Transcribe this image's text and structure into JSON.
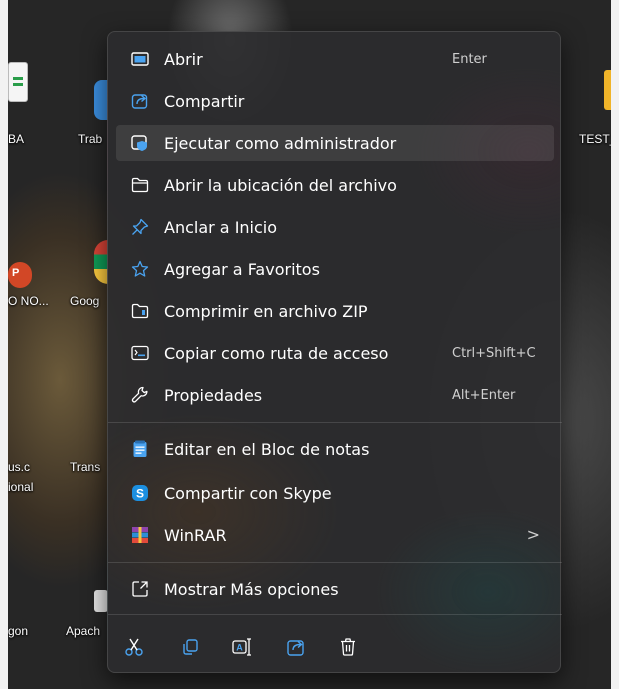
{
  "desktop": {
    "labels": [
      "BA",
      "Trab",
      "TEST_",
      "O NO...",
      "Goog",
      "us.c",
      "ional",
      "Trans",
      "gon",
      "Apach"
    ]
  },
  "menu": {
    "items": [
      {
        "label": "Abrir",
        "shortcut": "Enter",
        "icon": "open-icon"
      },
      {
        "label": "Compartir",
        "shortcut": "",
        "icon": "share-icon"
      },
      {
        "label": "Ejecutar como administrador",
        "shortcut": "",
        "icon": "admin-shield-icon"
      },
      {
        "label": "Abrir la ubicación del archivo",
        "shortcut": "",
        "icon": "folder-icon"
      },
      {
        "label": "Anclar a Inicio",
        "shortcut": "",
        "icon": "pin-icon"
      },
      {
        "label": "Agregar a Favoritos",
        "shortcut": "",
        "icon": "star-icon"
      },
      {
        "label": "Comprimir en archivo ZIP",
        "shortcut": "",
        "icon": "zip-folder-icon"
      },
      {
        "label": "Copiar como ruta de acceso",
        "shortcut": "Ctrl+Shift+C",
        "icon": "copy-path-icon"
      },
      {
        "label": "Propiedades",
        "shortcut": "Alt+Enter",
        "icon": "wrench-icon"
      },
      {
        "label": "Editar en el Bloc de notas",
        "shortcut": "",
        "icon": "notepad-icon"
      },
      {
        "label": "Compartir con Skype",
        "shortcut": "",
        "icon": "skype-icon"
      },
      {
        "label": "WinRAR",
        "shortcut": "",
        "icon": "winrar-icon",
        "submenu_glyph": ">"
      },
      {
        "label": "Mostrar Más opciones",
        "shortcut": "",
        "icon": "more-options-icon"
      }
    ],
    "bottom_actions": [
      "cut-icon",
      "copy-icon",
      "rename-icon",
      "share-icon",
      "delete-icon"
    ]
  },
  "colors": {
    "accent": "#4aa3f0",
    "menu_text": "#ffffff",
    "shortcut_text": "#d0d0d0",
    "skype": "#1c8fe0",
    "notepad": "#4aa3f0",
    "powerpoint": "#d24726",
    "folder_yellow": "#f0b429"
  }
}
